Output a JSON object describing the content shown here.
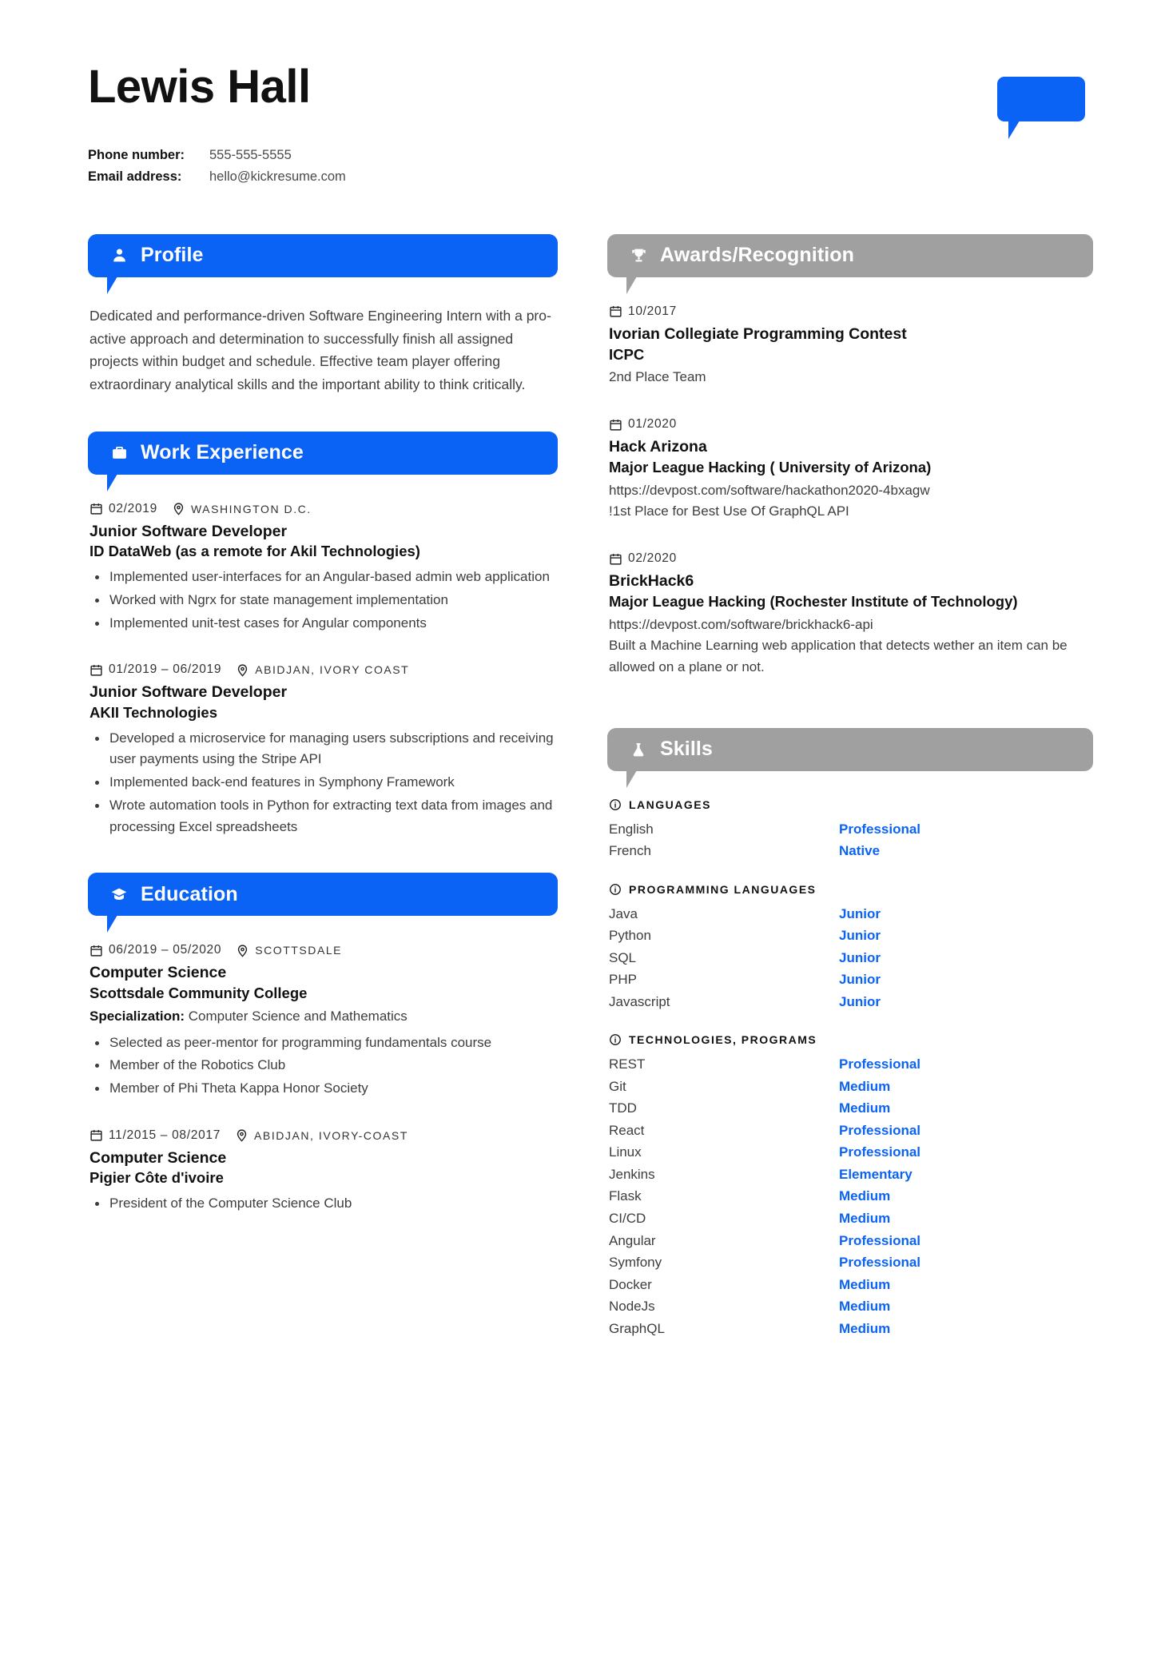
{
  "colors": {
    "accent": "#0b63f6",
    "gray_header": "#a0a0a0",
    "text": "#3d3d3d"
  },
  "brand": {
    "logo_name": "kickresume-bubble-logo"
  },
  "header": {
    "name": "Lewis Hall",
    "contact": [
      {
        "label": "Phone number:",
        "value": "555-555-5555",
        "name": "phone"
      },
      {
        "label": "Email address:",
        "value": "hello@kickresume.com",
        "name": "email"
      }
    ]
  },
  "sections": {
    "profile": {
      "title": "Profile",
      "icon": "user-icon",
      "text": "Dedicated and performance-driven Software Engineering Intern with a pro-active approach and determination to successfully finish all assigned projects within budget and schedule. Effective team player offering extraordinary analytical skills and the important ability to think critically."
    },
    "work_experience": {
      "title": "Work Experience",
      "icon": "briefcase-icon",
      "entries": [
        {
          "date": "02/2019",
          "location": "WASHINGTON D.C.",
          "title": "Junior Software Developer",
          "subtitle": "ID DataWeb (as a remote for Akil Technologies)",
          "bullets": [
            "Implemented user-interfaces for an Angular-based admin web application",
            "Worked with Ngrx for state management implementation",
            "Implemented unit-test cases for Angular components"
          ]
        },
        {
          "date": "01/2019 – 06/2019",
          "location": "ABIDJAN, IVORY COAST",
          "title": "Junior Software Developer",
          "subtitle": "AKII Technologies",
          "bullets": [
            "Developed a microservice for managing users subscriptions and receiving user payments using the Stripe API",
            "Implemented  back-end features in Symphony Framework",
            "Wrote automation tools in Python for extracting text data from images and processing Excel spreadsheets"
          ]
        }
      ]
    },
    "education": {
      "title": "Education",
      "icon": "graduation-cap-icon",
      "entries": [
        {
          "date": "06/2019 – 05/2020",
          "location": "SCOTTSDALE",
          "title": "Computer Science",
          "subtitle": "Scottsdale Community College",
          "spec_label": "Specialization:",
          "spec_value": " Computer Science and Mathematics",
          "bullets": [
            "Selected as peer-mentor for programming fundamentals course",
            "Member of the Robotics Club",
            "Member of Phi Theta Kappa Honor Society"
          ]
        },
        {
          "date": "11/2015 – 08/2017",
          "location": "ABIDJAN, IVORY-COAST",
          "title": "Computer Science",
          "subtitle": "Pigier Côte d'ivoire",
          "bullets": [
            "President of the Computer Science Club"
          ]
        }
      ]
    },
    "awards": {
      "title": "Awards/Recognition",
      "icon": "trophy-icon",
      "entries": [
        {
          "date": "10/2017",
          "title": "Ivorian Collegiate Programming Contest",
          "subtitle": "ICPC",
          "note": "2nd Place Team"
        },
        {
          "date": "01/2020",
          "title": "Hack Arizona",
          "subtitle": "Major League Hacking ( University of Arizona)",
          "link": "https://devpost.com/software/hackathon2020-4bxagw",
          "note": "!1st Place for Best Use Of GraphQL API"
        },
        {
          "date": "02/2020",
          "title": "BrickHack6",
          "subtitle": "Major League Hacking (Rochester Institute of Technology)",
          "link": "https://devpost.com/software/brickhack6-api",
          "note": "Built a Machine Learning web application that detects wether an item can be allowed on a plane or not."
        }
      ]
    },
    "skills": {
      "title": "Skills",
      "icon": "flask-icon",
      "groups": [
        {
          "name": "LANGUAGES",
          "icon": "info-icon",
          "items": [
            {
              "name": "English",
              "level": "Professional"
            },
            {
              "name": "French",
              "level": "Native"
            }
          ]
        },
        {
          "name": "PROGRAMMING LANGUAGES",
          "icon": "info-icon",
          "items": [
            {
              "name": "Java",
              "level": "Junior"
            },
            {
              "name": "Python",
              "level": "Junior"
            },
            {
              "name": "SQL",
              "level": "Junior"
            },
            {
              "name": "PHP",
              "level": "Junior"
            },
            {
              "name": "Javascript",
              "level": "Junior"
            }
          ]
        },
        {
          "name": "TECHNOLOGIES, PROGRAMS",
          "icon": "info-icon",
          "items": [
            {
              "name": "REST",
              "level": "Professional"
            },
            {
              "name": "Git",
              "level": "Medium"
            },
            {
              "name": "TDD",
              "level": "Medium"
            },
            {
              "name": "React",
              "level": "Professional"
            },
            {
              "name": "Linux",
              "level": "Professional"
            },
            {
              "name": "Jenkins",
              "level": "Elementary"
            },
            {
              "name": "Flask",
              "level": "Medium"
            },
            {
              "name": "CI/CD",
              "level": "Medium"
            },
            {
              "name": "Angular",
              "level": "Professional"
            },
            {
              "name": "Symfony",
              "level": "Professional"
            },
            {
              "name": "Docker",
              "level": "Medium"
            },
            {
              "name": "NodeJs",
              "level": "Medium"
            },
            {
              "name": "GraphQL",
              "level": "Medium"
            }
          ]
        }
      ]
    }
  }
}
